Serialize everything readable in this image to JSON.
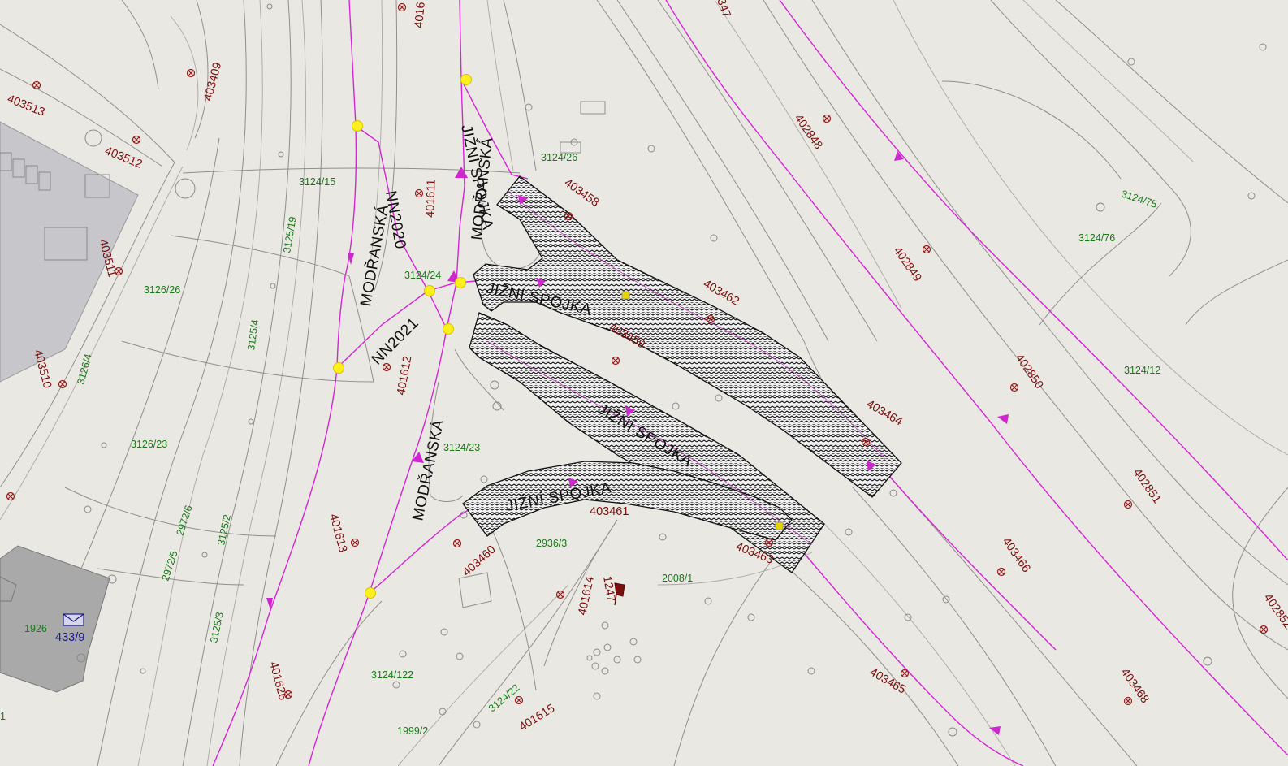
{
  "map": {
    "road_labels": [
      "MODŘANSKÁ",
      "NN2020",
      "NN2021",
      "MODŘANSKÁ",
      "JIŽNÍ SPOJKA",
      "MODŘANSKÁ",
      "JIŽNÍ SPOJKA",
      "JIŽNÍ SPOJKA",
      "JIŽNÍ SPOJKA"
    ],
    "parcels": [
      "3124/15",
      "3125/19",
      "3124/26",
      "3124/24",
      "3126/26",
      "3125/4",
      "3126/4",
      "3126/23",
      "3124/23",
      "2972/6",
      "2972/5",
      "3125/2",
      "3125/3",
      "1926",
      "2936/3",
      "2008/1",
      "3124/122",
      "3124/22",
      "1999/2",
      "3124/75",
      "3124/76",
      "3124/12",
      "1"
    ],
    "points": [
      "4016",
      "403409",
      "403513",
      "403512",
      "401611",
      "403511",
      "403510",
      "401612",
      "401613",
      "401626",
      "403458",
      "403462",
      "403459",
      "403464",
      "403461",
      "403460",
      "403463",
      "401614",
      "1247",
      "401615",
      "402848",
      "402849",
      "402850",
      "402851",
      "403466",
      "403465",
      "403468",
      "40285Z",
      "347"
    ],
    "house_number": "433/9",
    "colors": {
      "background": "#e9e8e2",
      "network_line": "#d526d5",
      "node": "#ffef1a",
      "parcel_text": "#1a7a1a",
      "point_text": "#7a0f0f",
      "building": "#a9a9aa"
    },
    "icons": [
      "envelope-icon",
      "survey-point-icon",
      "flow-arrow-icon"
    ]
  }
}
